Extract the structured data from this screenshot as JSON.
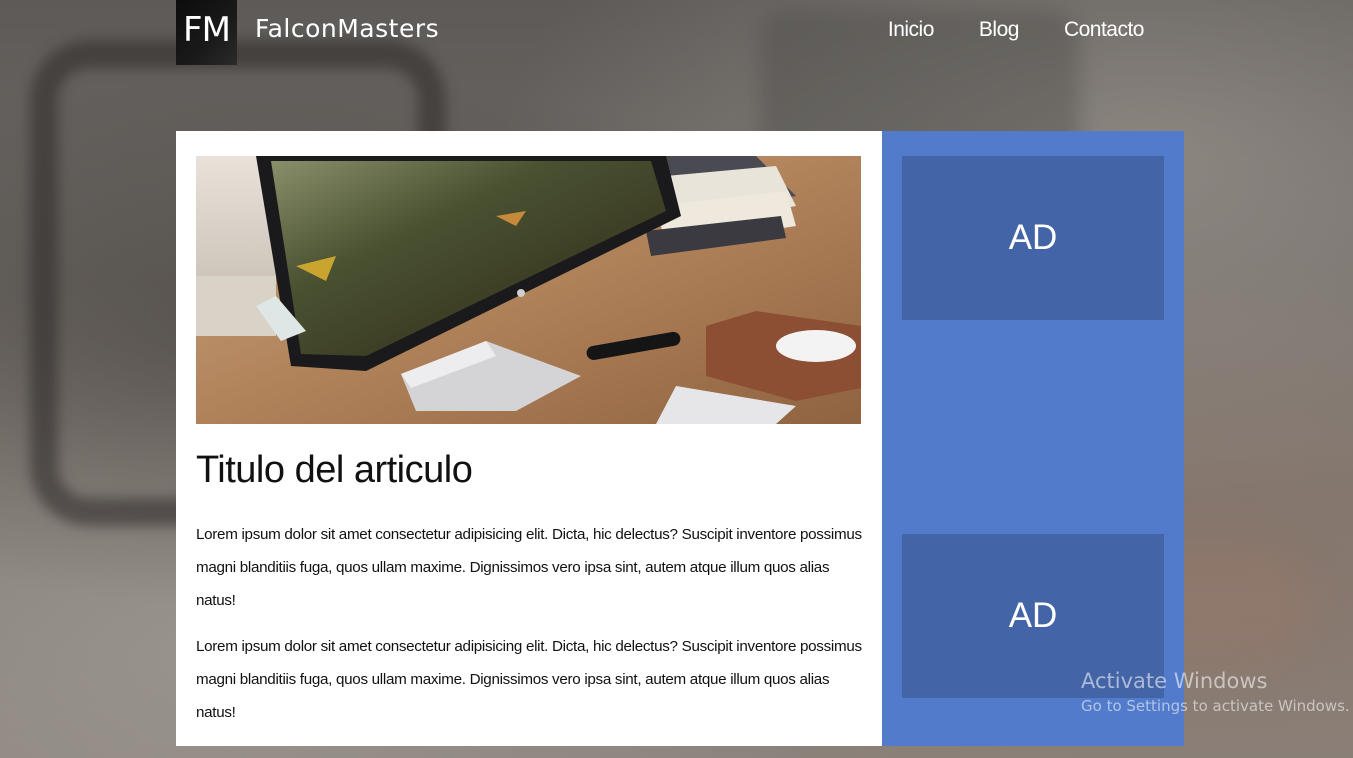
{
  "header": {
    "logo_mark": "FM",
    "brand": "FalconMasters",
    "nav": [
      {
        "label": "Inicio"
      },
      {
        "label": "Blog"
      },
      {
        "label": "Contacto"
      }
    ]
  },
  "article": {
    "title": "Titulo del articulo",
    "paragraphs": [
      "Lorem ipsum dolor sit amet consectetur adipisicing elit. Dicta, hic delectus? Suscipit inventore possimus magni blanditiis fuga, quos ullam maxime. Dignissimos vero ipsa sint, autem atque illum quos alias natus!",
      "Lorem ipsum dolor sit amet consectetur adipisicing elit. Dicta, hic delectus? Suscipit inventore possimus magni blanditiis fuga, quos ullam maxime. Dignissimos vero ipsa sint, autem atque illum quos alias natus!"
    ]
  },
  "sidebar": {
    "ads": [
      {
        "label": "AD"
      },
      {
        "label": "AD"
      }
    ]
  },
  "watermark": {
    "title": "Activate Windows",
    "subtitle": "Go to Settings to activate Windows."
  },
  "colors": {
    "sidebar": "#527bcb",
    "ad_box": "#4364a6",
    "main_bg": "#ffffff"
  }
}
